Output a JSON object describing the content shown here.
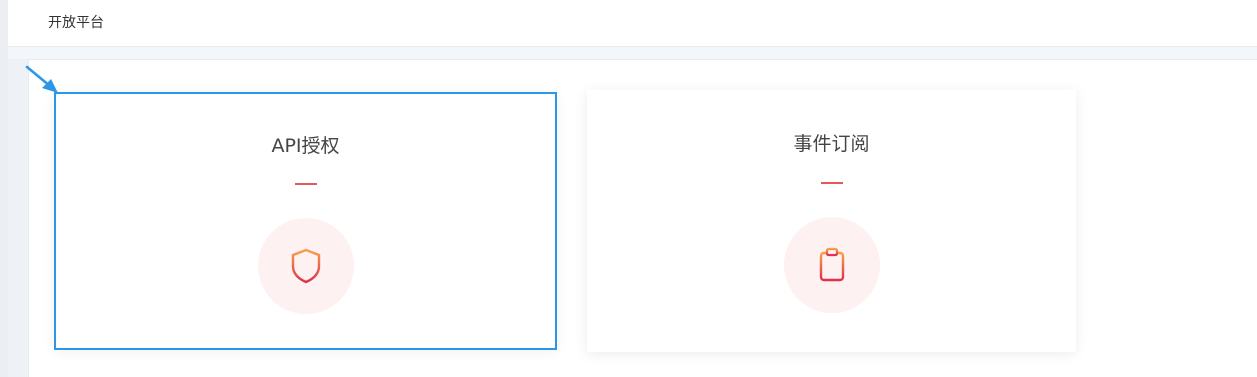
{
  "header": {
    "title": "开放平台"
  },
  "cards": [
    {
      "title": "API授权",
      "icon": "shield-chart-icon",
      "selected": true
    },
    {
      "title": "事件订阅",
      "icon": "clipboard-icon",
      "selected": false
    }
  ],
  "colors": {
    "selected_border": "#2b97e6",
    "accent_dash": "#e25b5b",
    "icon_bg": "#fdf1f1",
    "icon_gradient_start": "#f7a04b",
    "icon_gradient_end": "#e0304a"
  }
}
